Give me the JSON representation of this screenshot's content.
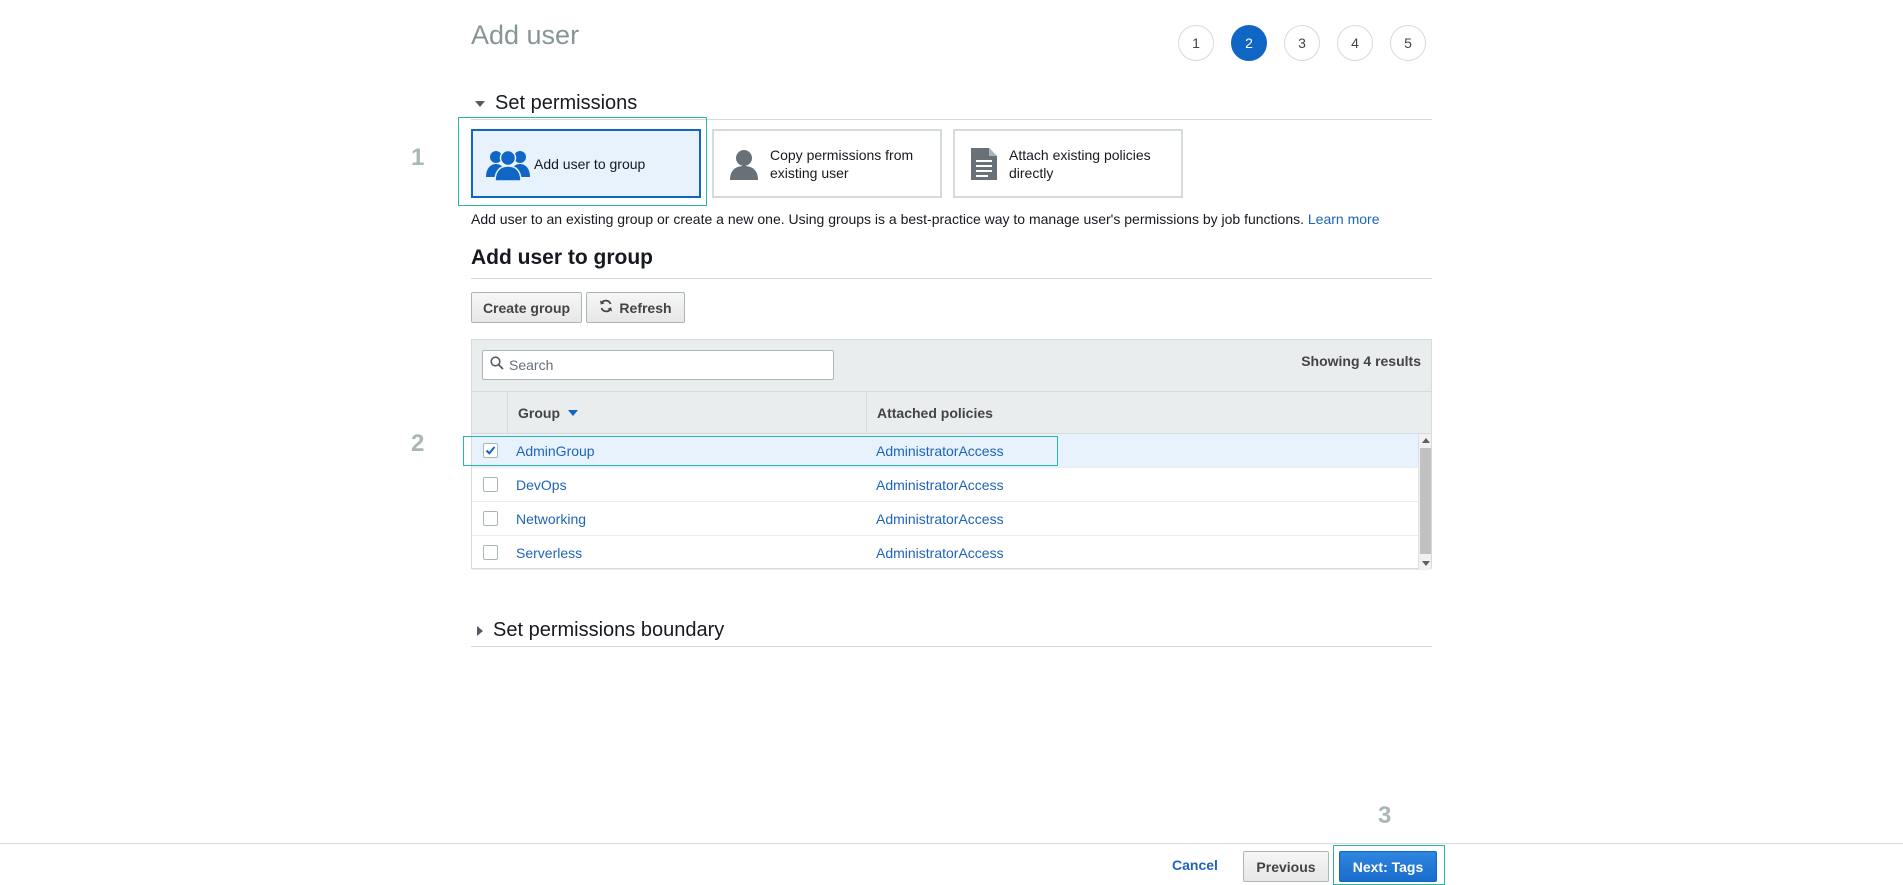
{
  "page": {
    "title": "Add user"
  },
  "steps": [
    {
      "label": "1",
      "active": false
    },
    {
      "label": "2",
      "active": true
    },
    {
      "label": "3",
      "active": false
    },
    {
      "label": "4",
      "active": false
    },
    {
      "label": "5",
      "active": false
    }
  ],
  "annotations": {
    "one": "1",
    "two": "2",
    "three": "3"
  },
  "permissions": {
    "section_title": "Set permissions",
    "options": [
      {
        "label": "Add user to group",
        "icon": "users-group-icon",
        "selected": true
      },
      {
        "label": "Copy permissions from existing user",
        "icon": "user-icon",
        "selected": false
      },
      {
        "label": "Attach existing policies directly",
        "icon": "document-icon",
        "selected": false
      }
    ],
    "description": "Add user to an existing group or create a new one. Using groups is a best-practice way to manage user's permissions by job functions.",
    "learn_more": "Learn more"
  },
  "group_section": {
    "title": "Add user to group",
    "create_group_label": "Create group",
    "refresh_label": "Refresh",
    "search_placeholder": "Search",
    "results_text": "Showing 4 results",
    "columns": {
      "group": "Group",
      "policies": "Attached policies"
    },
    "rows": [
      {
        "group": "AdminGroup",
        "policies": "AdministratorAccess",
        "checked": true
      },
      {
        "group": "DevOps",
        "policies": "AdministratorAccess",
        "checked": false
      },
      {
        "group": "Networking",
        "policies": "AdministratorAccess",
        "checked": false
      },
      {
        "group": "Serverless",
        "policies": "AdministratorAccess",
        "checked": false
      }
    ]
  },
  "boundary": {
    "section_title": "Set permissions boundary"
  },
  "footer": {
    "cancel_label": "Cancel",
    "previous_label": "Previous",
    "next_label": "Next: Tags"
  },
  "colors": {
    "primary": "#0f66c4",
    "highlight": "#2bb5a5",
    "link": "#1f64b9",
    "selected_bg": "#e7f2fd"
  }
}
